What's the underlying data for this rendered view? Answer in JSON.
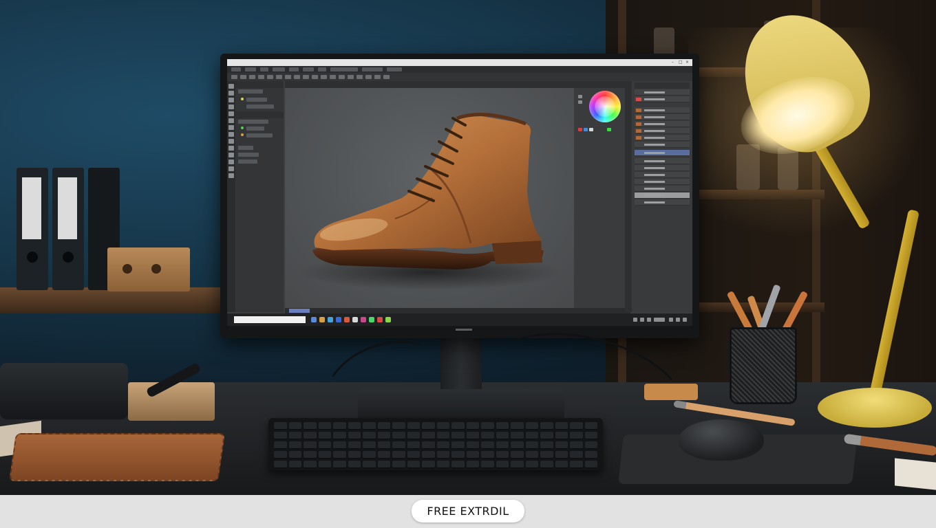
{
  "caption": {
    "text": "FREE EXTRDIL"
  },
  "colors": {
    "wall_blue": "#163548",
    "boot_leather": "#b5703a",
    "lamp_yellow": "#e8cf6a",
    "canvas_gray": "#555759",
    "panel_selected": "#5a6e9e"
  },
  "icons": {
    "color_wheel": "color-wheel-icon",
    "lamp": "desk-lamp-icon",
    "keyboard": "keyboard-icon",
    "mouse": "mouse-icon"
  }
}
